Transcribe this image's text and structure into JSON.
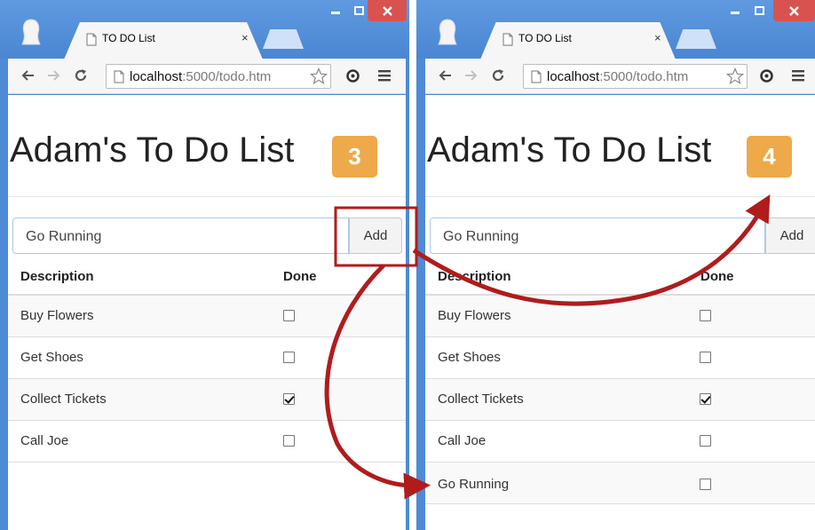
{
  "colors": {
    "window_frame": "#4e8ad6",
    "close_button": "#d8534f",
    "badge": "#eeaa4a",
    "annotation": "#b01c1c"
  },
  "left": {
    "tab_title": "TO DO List",
    "tab_close": "×",
    "url_host": "localhost",
    "url_path": ":5000/todo.htm",
    "heading": "Adam's To Do List",
    "count": "3",
    "input_value": "Go Running",
    "add_label": "Add",
    "col_description": "Description",
    "col_done": "Done",
    "items": [
      {
        "description": "Buy Flowers",
        "done": false
      },
      {
        "description": "Get Shoes",
        "done": false
      },
      {
        "description": "Collect Tickets",
        "done": true
      },
      {
        "description": "Call Joe",
        "done": false
      }
    ]
  },
  "right": {
    "tab_title": "TO DO List",
    "tab_close": "×",
    "url_host": "localhost",
    "url_path": ":5000/todo.htm",
    "heading": "Adam's To Do List",
    "count": "4",
    "input_value": "Go Running",
    "add_label": "Add",
    "col_description": "Description",
    "col_done": "Done",
    "items": [
      {
        "description": "Buy Flowers",
        "done": false
      },
      {
        "description": "Get Shoes",
        "done": false
      },
      {
        "description": "Collect Tickets",
        "done": true
      },
      {
        "description": "Call Joe",
        "done": false
      },
      {
        "description": "Go Running",
        "done": false
      }
    ]
  },
  "icons": {
    "back": "back-arrow-icon",
    "forward": "forward-arrow-icon",
    "reload": "reload-icon",
    "page": "page-icon",
    "bookmark": "bookmark-star-icon",
    "extension": "extension-icon",
    "menu": "menu-icon",
    "profile": "profile-icon",
    "minimize": "minimize-icon",
    "maximize": "maximize-icon",
    "close": "close-icon"
  }
}
